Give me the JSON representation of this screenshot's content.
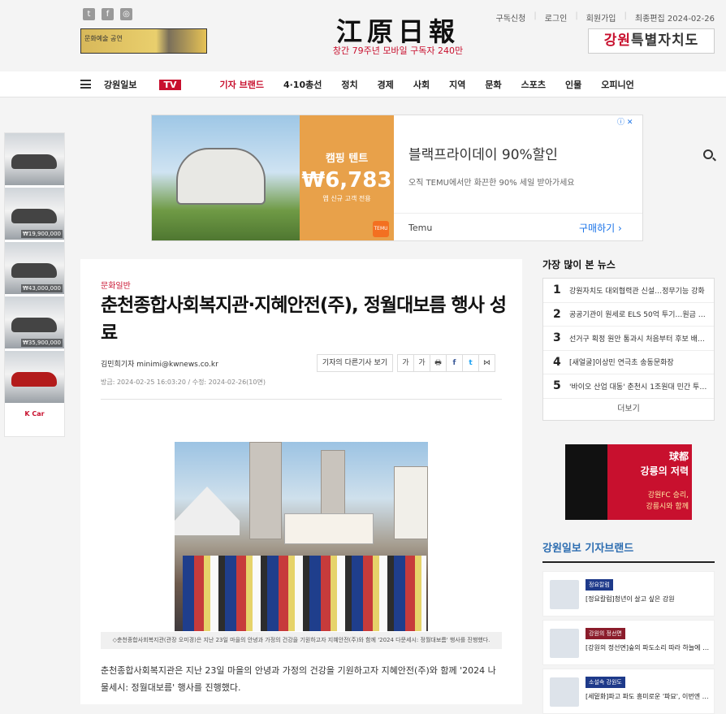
{
  "header": {
    "social": [
      "twitter-icon",
      "facebook-icon",
      "instagram-icon"
    ],
    "left_banner_text": "문화예술 공연",
    "logo": "江原日報",
    "slogan": "창간 79주년 모바일 구독자 240만",
    "links": [
      "구독신청",
      "로그인",
      "회원가입"
    ],
    "last_edit": "최종편집 2024-02-26",
    "right_banner": {
      "highlight": "강원",
      "rest": "특별자치도"
    }
  },
  "nav": {
    "brand": "강원일보",
    "tv": "TV",
    "items": [
      "기자 브랜드",
      "4·10총선",
      "정치",
      "경제",
      "사회",
      "지역",
      "문화",
      "스포츠",
      "인물",
      "오피니언"
    ]
  },
  "side_ads": {
    "prices": [
      "₩19,900,000",
      "₩43,000,000",
      "₩35,900,000"
    ],
    "brand": "K Car"
  },
  "ad": {
    "badge_title": "캠핑 텐트",
    "price": "₩6,783",
    "badge_sub": "앱 신규 고객 전용",
    "headline": "블랙프라이데이 90%할인",
    "sub": "오직 TEMU에서만 화끈한 90% 세일 받아가세요",
    "brand": "Temu",
    "cta": "구매하기 ›",
    "temu_logo": "TEMU"
  },
  "article": {
    "category": "문화일반",
    "title": "춘천종합사회복지관·지혜안전(주), 정월대보름 행사 성료",
    "byline": "김민희기자 minimi@kwnews.co.kr",
    "more_button": "기자의 다른기사 보기",
    "tools": [
      "가",
      "가",
      "🖶",
      "f",
      "t",
      "⋈"
    ],
    "dates": "방금: 2024-02-25 16:03:20 / 수정: 2024-02-26(10면)",
    "caption": "◇춘천종합사회복지관(관장 오미경)은 지난 23일 마을의 안녕과 가정의 건강을 기원하고자 지혜안전(주)와 함께 '2024 다문세시: 정월대보름' 행사를 진행했다.",
    "body": "춘천종합사회복지관은 지난 23일 마을의 안녕과 가정의 건강을 기원하고자 지혜안전(주)와 함께 '2024 나물세시: 정월대보름' 행사를 진행했다."
  },
  "sidebar": {
    "popular_title": "가장 많이 본 뉴스",
    "popular": [
      {
        "n": "1",
        "t": "강원자치도 대외협력관 신설…정무기능 강화"
      },
      {
        "n": "2",
        "t": "공공기관이 원세로 ELS 50억 투기…원금 …"
      },
      {
        "n": "3",
        "t": "선거구 획정 원안 통과시 처음부터 후보 배…"
      },
      {
        "n": "4",
        "t": "[새얼굴]이상민 연극초 송동문화장"
      },
      {
        "n": "5",
        "t": "'바이오 산업 대동' 춘천시 1조원대 민간 투…"
      }
    ],
    "more": "더보기",
    "fc_ad": {
      "line1": "球都",
      "line2": "강릉의 저력",
      "line3": "강원FC 승리,",
      "line4": "강릉시와 함께"
    },
    "brand_title": "강원일보 기자브랜드",
    "brands": [
      {
        "tag": "정요칼럼",
        "text": "[정요칼럼]청년이 살고 싶은 강원"
      },
      {
        "tag": "강원의 정선면",
        "text": "[강원의 정선면]숲의 파도소리 따라 하늘에 …"
      },
      {
        "tag": "소설속 강원도",
        "text": "[세밑화]파고 파도 흥미로운 '파묘', 이번엔 …"
      }
    ]
  }
}
